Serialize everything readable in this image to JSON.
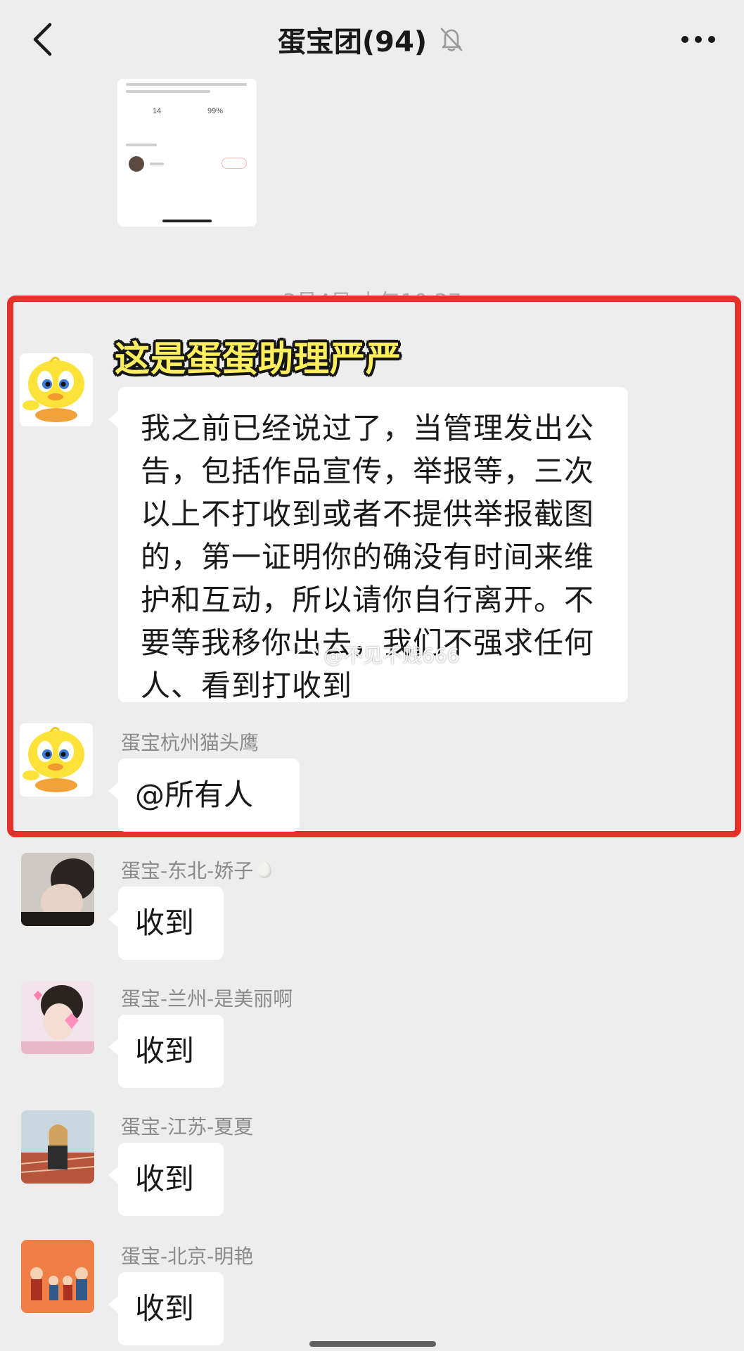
{
  "header": {
    "title": "蛋宝团(94)",
    "back_icon": "chevron-left-icon",
    "mute_icon": "bell-off-icon",
    "more_icon": "ellipsis-icon"
  },
  "shared_thumb": {
    "stat_1": "14",
    "stat_2": "99%"
  },
  "timestamp": "3月4日 上午10:27",
  "caption": "这是蛋蛋助理严严",
  "messages": [
    {
      "sender": "",
      "text": "我之前已经说过了，当管理发出公告，包括作品宣传，举报等，三次以上不打收到或者不提供举报截图的，第一证明你的确没有时间来维护和互动，所以请你自行离开。不要等我移你出去，我们不强求任何人、看到打收到"
    },
    {
      "sender": "蛋宝杭州猫头鹰",
      "text": "@所有人"
    },
    {
      "sender": "蛋宝-东北-娇子",
      "text": "收到"
    },
    {
      "sender": "蛋宝-兰州-是美丽啊",
      "text": "收到"
    },
    {
      "sender": "蛋宝-江苏-夏夏",
      "text": "收到"
    },
    {
      "sender": "蛋宝-北京-明艳",
      "text": "收到"
    }
  ],
  "watermark": "@不见不贱666",
  "colors": {
    "background": "#ededed",
    "highlight_border": "#e8312b",
    "caption_fill": "#ffef5e",
    "bubble": "#ffffff"
  }
}
